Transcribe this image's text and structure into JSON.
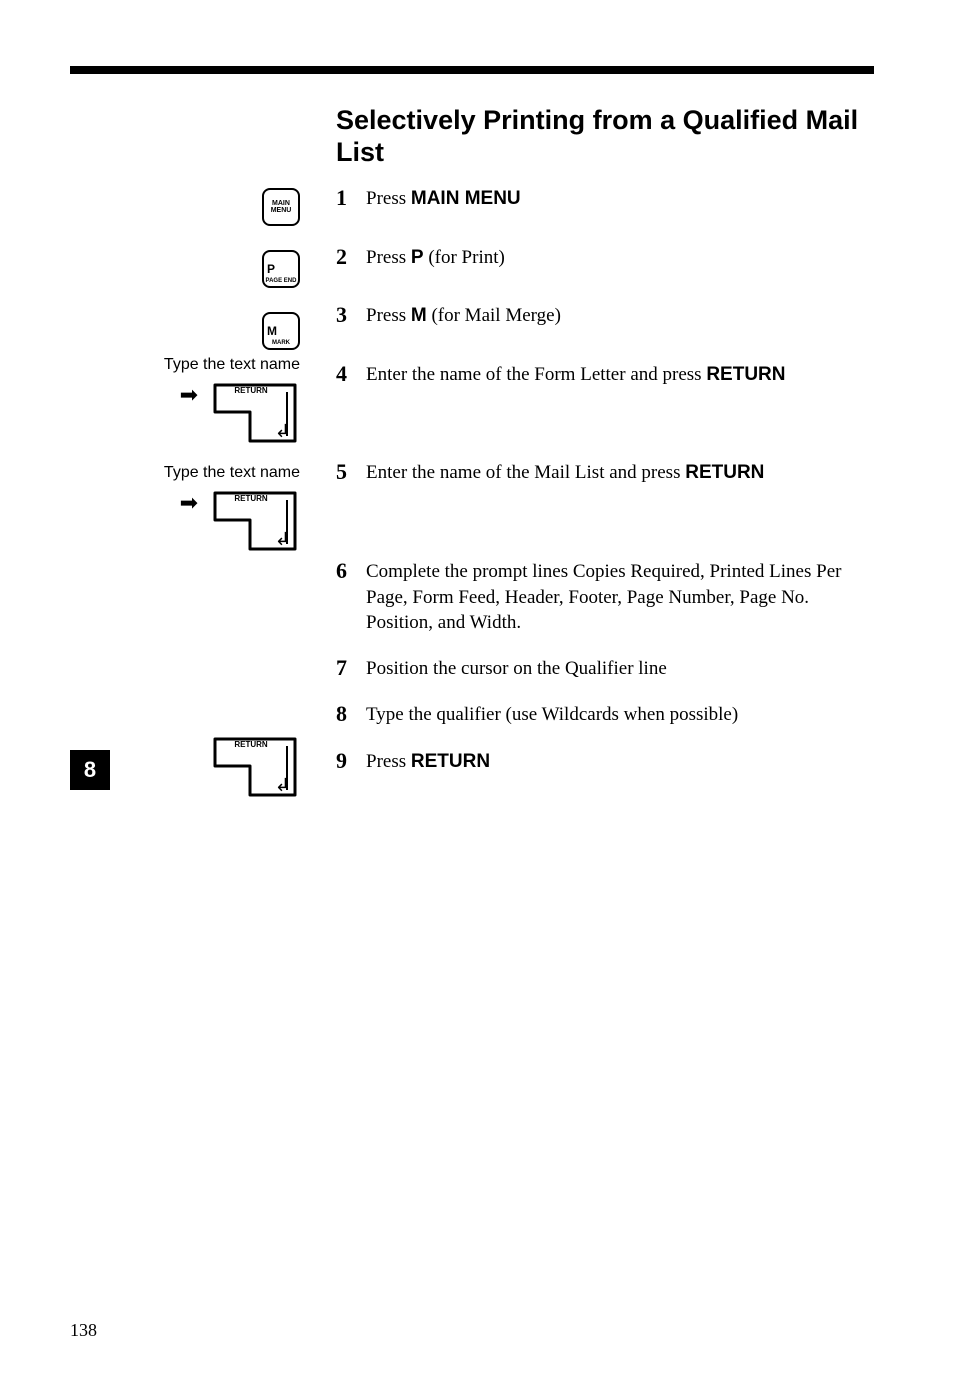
{
  "title": "Selectively Printing from a Qualified Mail List",
  "left": {
    "keys": {
      "main_menu_line1": "MAIN",
      "main_menu_line2": "MENU",
      "p_big": "P",
      "p_tiny": "PAGE END",
      "m_big": "M",
      "m_tiny": "MARK",
      "return_label": "RETURN"
    },
    "captions": {
      "type_text_name_1": "Type the text name",
      "type_text_name_2": "Type the text name"
    },
    "glyphs": {
      "arrow": "➡",
      "enter": "↲"
    }
  },
  "steps": [
    {
      "num": "1",
      "pre": "Press ",
      "bold": "MAIN MENU",
      "post": ""
    },
    {
      "num": "2",
      "pre": "Press ",
      "bold": "P",
      "post": " (for Print)"
    },
    {
      "num": "3",
      "pre": "Press ",
      "bold": "M",
      "post": " (for Mail Merge)"
    },
    {
      "num": "4",
      "pre": "Enter the name of the Form Letter and press ",
      "bold": "RETURN",
      "post": ""
    },
    {
      "num": "5",
      "pre": "Enter the name of the Mail List and press ",
      "bold": "RETURN",
      "post": ""
    },
    {
      "num": "6",
      "pre": "Complete the prompt lines Copies Required, Printed Lines Per Page, Form Feed, Header, Footer, Page Number, Page No. Position, and Width.",
      "bold": "",
      "post": ""
    },
    {
      "num": "7",
      "pre": "Position the cursor on the Qualifier line",
      "bold": "",
      "post": ""
    },
    {
      "num": "8",
      "pre": "Type the qualifier (use Wildcards when possible)",
      "bold": "",
      "post": ""
    },
    {
      "num": "9",
      "pre": "Press ",
      "bold": "RETURN",
      "post": ""
    }
  ],
  "side_tab": "8",
  "page_number": "138"
}
